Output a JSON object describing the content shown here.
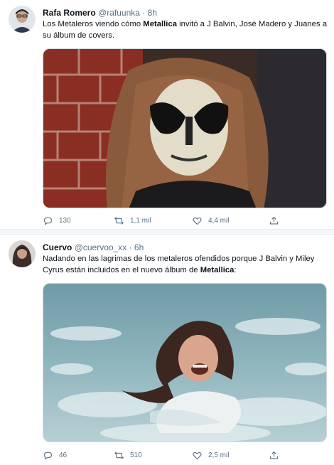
{
  "tweets": [
    {
      "author": "Rafa Romero",
      "handle": "@rafuunka",
      "separator": "·",
      "time": "8h",
      "text_before": "Los Metaleros viendo cómo ",
      "text_bold": "Metallica",
      "text_after": " invitó a J Balvin, José Madero y Juanes a su álbum de covers.",
      "replies": "130",
      "retweets": "1,1 mil",
      "likes": "4,4 mil"
    },
    {
      "author": "Cuervo",
      "handle": "@cuervoo_xx",
      "separator": "·",
      "time": "6h",
      "text_before": "Nadando en las lagrimas de los metaleros ofendidos porque J Balvin y Miley Cyrus están incluidos en el nuevo álbum de ",
      "text_bold": "Metallica",
      "text_after": ":",
      "replies": "46",
      "retweets": "510",
      "likes": "2,5 mil"
    }
  ],
  "icons": {
    "reply": "reply-icon",
    "retweet": "retweet-icon",
    "like": "heart-icon",
    "share": "share-icon"
  },
  "colors": {
    "secondary_text": "#5b7083",
    "border": "#cfd9de",
    "separator_bg": "#f5f8fa"
  }
}
